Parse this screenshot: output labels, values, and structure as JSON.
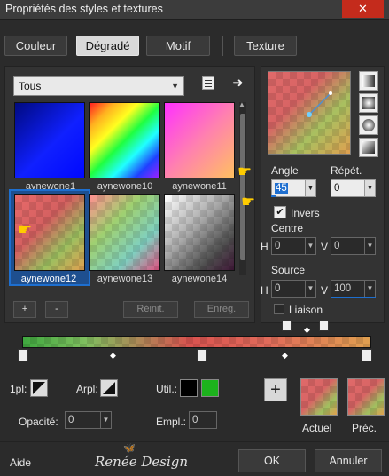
{
  "window": {
    "title": "Propriétés des styles et textures",
    "close_glyph": "✕"
  },
  "tabs": [
    {
      "label": "Couleur",
      "active": false
    },
    {
      "label": "Dégradé",
      "active": true
    },
    {
      "label": "Motif",
      "active": false
    },
    {
      "label": "Texture",
      "active": false
    }
  ],
  "category": {
    "value": "Tous"
  },
  "library": {
    "items": [
      {
        "label": "aynewone1",
        "colors": [
          "#0a0aa0",
          "#2030ff",
          "#0008ff"
        ]
      },
      {
        "label": "aynewone10",
        "colors": [
          "#ff2020",
          "#ffff20",
          "#20ff40",
          "#20ffff",
          "#2040ff"
        ]
      },
      {
        "label": "aynewone11",
        "colors": [
          "#ff40ff",
          "#ffa060",
          "#ffd060"
        ]
      },
      {
        "label": "aynewone12",
        "colors": [
          "#e86a6a",
          "#8ab85a",
          "#e0a050"
        ],
        "selected": true
      },
      {
        "label": "aynewone13",
        "colors": [
          "#a0d070",
          "#80d0c0",
          "#e06090"
        ]
      },
      {
        "label": "aynewone14",
        "colors": [
          "#ffffff",
          "#606060",
          "#402040"
        ]
      }
    ]
  },
  "lib_buttons": {
    "add": "+",
    "remove": "-",
    "reset": "Réinit.",
    "save": "Enreg."
  },
  "props": {
    "angle_label": "Angle",
    "angle_value": "45",
    "repeat_label": "Répét.",
    "repeat_value": "0",
    "invert_label": "Invers",
    "invert_checked": true,
    "center_label": "Centre",
    "h_label": "H",
    "v_label": "V",
    "center_h": "0",
    "center_v": "0",
    "source_label": "Source",
    "source_h": "0",
    "source_v": "100",
    "link_label": "Liaison"
  },
  "editor": {
    "opl_label": "1pl:",
    "arpl_label": "Arpl:",
    "util_label": "Util.:",
    "opacity_label": "Opacité:",
    "opacity_value": "0",
    "empl_label": "Empl.:",
    "empl_value": "0",
    "util_colors": [
      "#000000",
      "#1db31d"
    ],
    "add_glyph": "+"
  },
  "preview": {
    "current_label": "Actuel",
    "previous_label": "Préc."
  },
  "footer": {
    "help": "Aide",
    "brand": "Renée Design",
    "ok": "OK",
    "cancel": "Annuler"
  },
  "colors": {
    "gradient_red": "#d9534f",
    "gradient_green": "#8fbf5a",
    "gradient_orange": "#e0a050",
    "accent_blue": "#1e6fcf"
  }
}
